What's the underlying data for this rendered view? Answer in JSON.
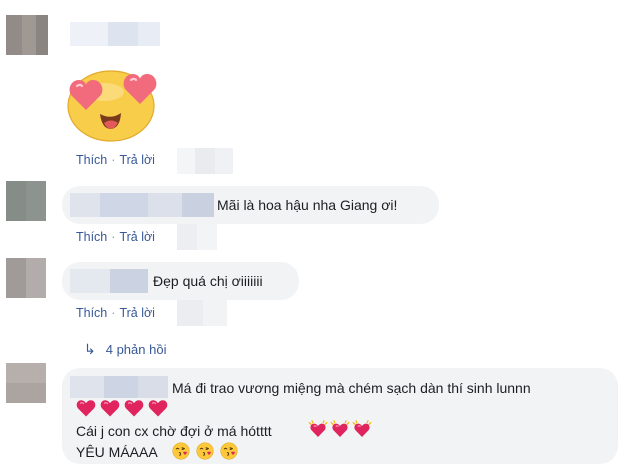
{
  "comments": [
    {
      "text": "",
      "like_label": "Thích",
      "reply_label": "Trả lời",
      "separator": "·",
      "sticker": "heart-eyes-face-sticker"
    },
    {
      "text": "Mãi là hoa hậu nha Giang ơi!",
      "like_label": "Thích",
      "reply_label": "Trả lời",
      "separator": "·"
    },
    {
      "text": "Đẹp quá chị ơiiiiiii",
      "like_label": "Thích",
      "reply_label": "Trả lời",
      "separator": "·",
      "replies_label": "4 phản hồi",
      "replies_icon": "reply-arrow-icon"
    },
    {
      "line1": "Má đi trao vương miệng mà chém sạch dàn thí sinh lunnn",
      "line3_text": "Cái j con cx chờ đợi ở má hótttt",
      "line4_text": "YÊU MÁAAA",
      "line2_icons": [
        "red-heart-icon",
        "red-heart-icon",
        "red-heart-icon",
        "red-heart-icon"
      ],
      "line3_icons": [
        "sparkling-heart-icon",
        "sparkling-heart-icon",
        "sparkling-heart-icon"
      ],
      "line4_icons": [
        "kiss-face-icon",
        "kiss-face-icon",
        "kiss-face-icon"
      ]
    }
  ],
  "colors": {
    "link": "#385898",
    "bubble": "#f2f3f5",
    "text": "#1c1e21",
    "heart": "#e0245e"
  }
}
